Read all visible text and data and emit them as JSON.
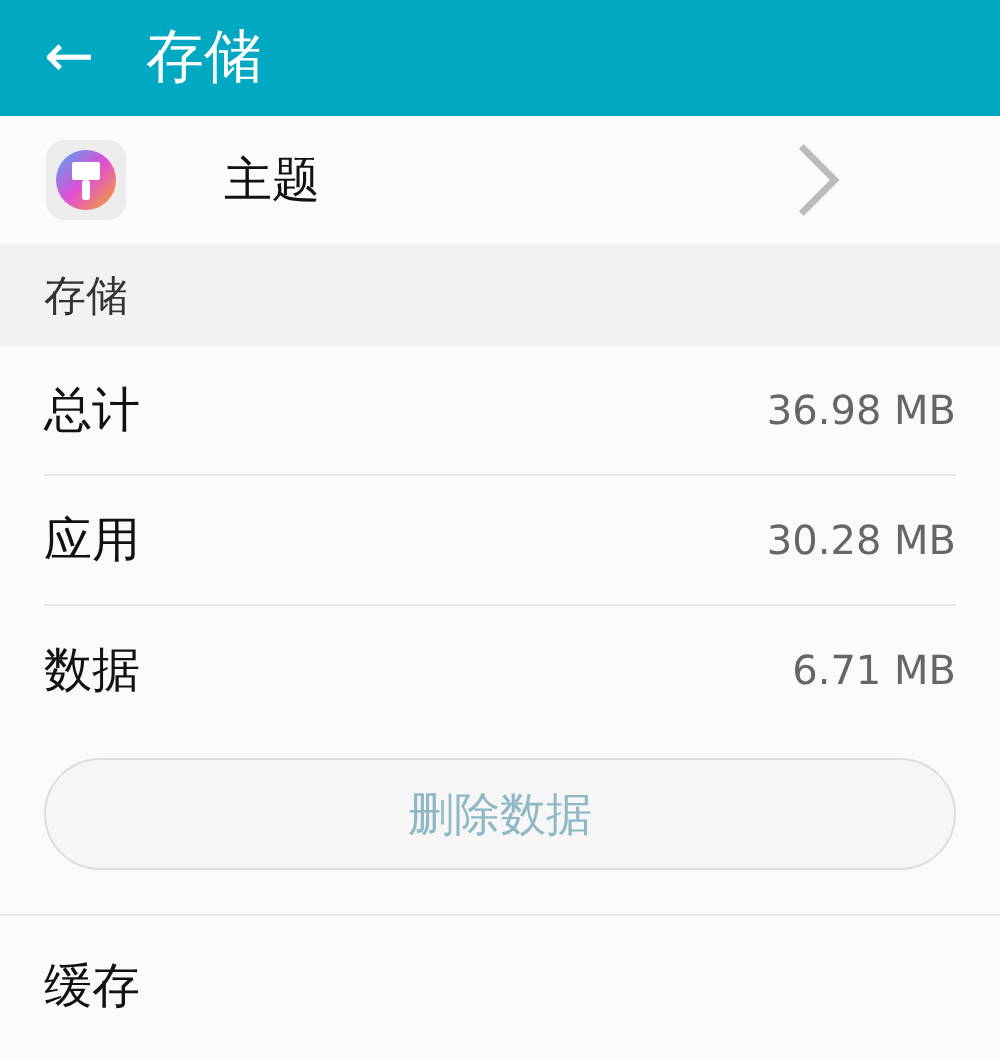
{
  "app_bar": {
    "back_icon": "←",
    "title": "存储"
  },
  "app_row": {
    "label": "主题"
  },
  "section": {
    "title": "存储"
  },
  "rows": [
    {
      "label": "总计",
      "value": "36.98 MB"
    },
    {
      "label": "应用",
      "value": "30.28 MB"
    },
    {
      "label": "数据",
      "value": "6.71 MB"
    }
  ],
  "delete_button": {
    "label": "删除数据",
    "disabled": true
  },
  "cache_row": {
    "label": "缓存"
  }
}
